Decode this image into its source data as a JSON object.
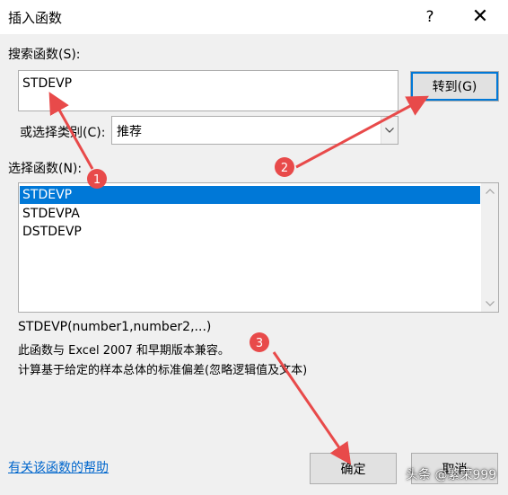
{
  "dialog": {
    "title": "插入函数",
    "help_glyph": "?",
    "close_glyph": "✕"
  },
  "search": {
    "label": "搜索函数(S):",
    "value": "STDEVP",
    "go_button": "转到(G)"
  },
  "category": {
    "label": "或选择类别(C):",
    "selected": "推荐"
  },
  "function_list": {
    "label": "选择函数(N):",
    "items": [
      "STDEVP",
      "STDEVPA",
      "DSTDEVP"
    ],
    "selected_index": 0
  },
  "details": {
    "signature": "STDEVP(number1,number2,...)",
    "line1": "此函数与 Excel 2007 和早期版本兼容。",
    "line2": "计算基于给定的样本总体的标准偏差(忽略逻辑值及文本)"
  },
  "footer": {
    "help_link": "有关该函数的帮助",
    "ok_button": "确定",
    "cancel_button": "取消"
  },
  "annotations": {
    "badges": [
      "1",
      "2",
      "3"
    ],
    "color": "#e84a4a"
  },
  "watermark": "头条 @繁荣999",
  "colors": {
    "accent": "#0078d7",
    "link": "#0066cc",
    "annotation": "#e84a4a"
  }
}
